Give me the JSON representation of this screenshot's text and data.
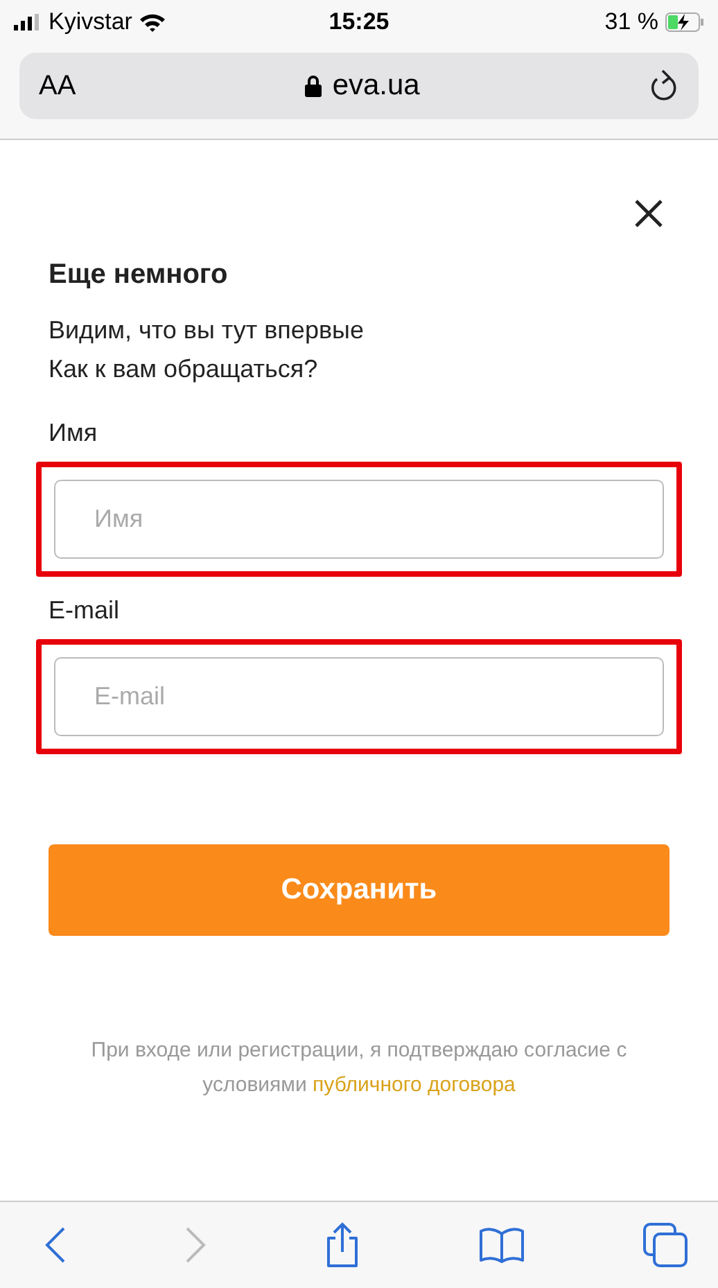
{
  "status_bar": {
    "carrier": "Kyivstar",
    "time": "15:25",
    "battery": "31 %",
    "charging": true
  },
  "browser": {
    "text_size": "AA",
    "url": "eva.ua",
    "secure": true
  },
  "dialog": {
    "title": "Еще немного",
    "subtitle_lines": [
      "Видим, что вы тут впервые",
      "Как к вам обращаться?"
    ],
    "fields": [
      {
        "label": "Имя",
        "placeholder": "Имя",
        "highlighted": true
      },
      {
        "label": "E-mail",
        "placeholder": "E-mail",
        "highlighted": true
      }
    ],
    "submit": "Сохранить",
    "legal": {
      "text": "При входе или регистрации, я подтверждаю согласие с условиями",
      "link": "публичного договора"
    }
  },
  "toolbar": {
    "back_disabled": false,
    "forward_disabled": true
  }
}
